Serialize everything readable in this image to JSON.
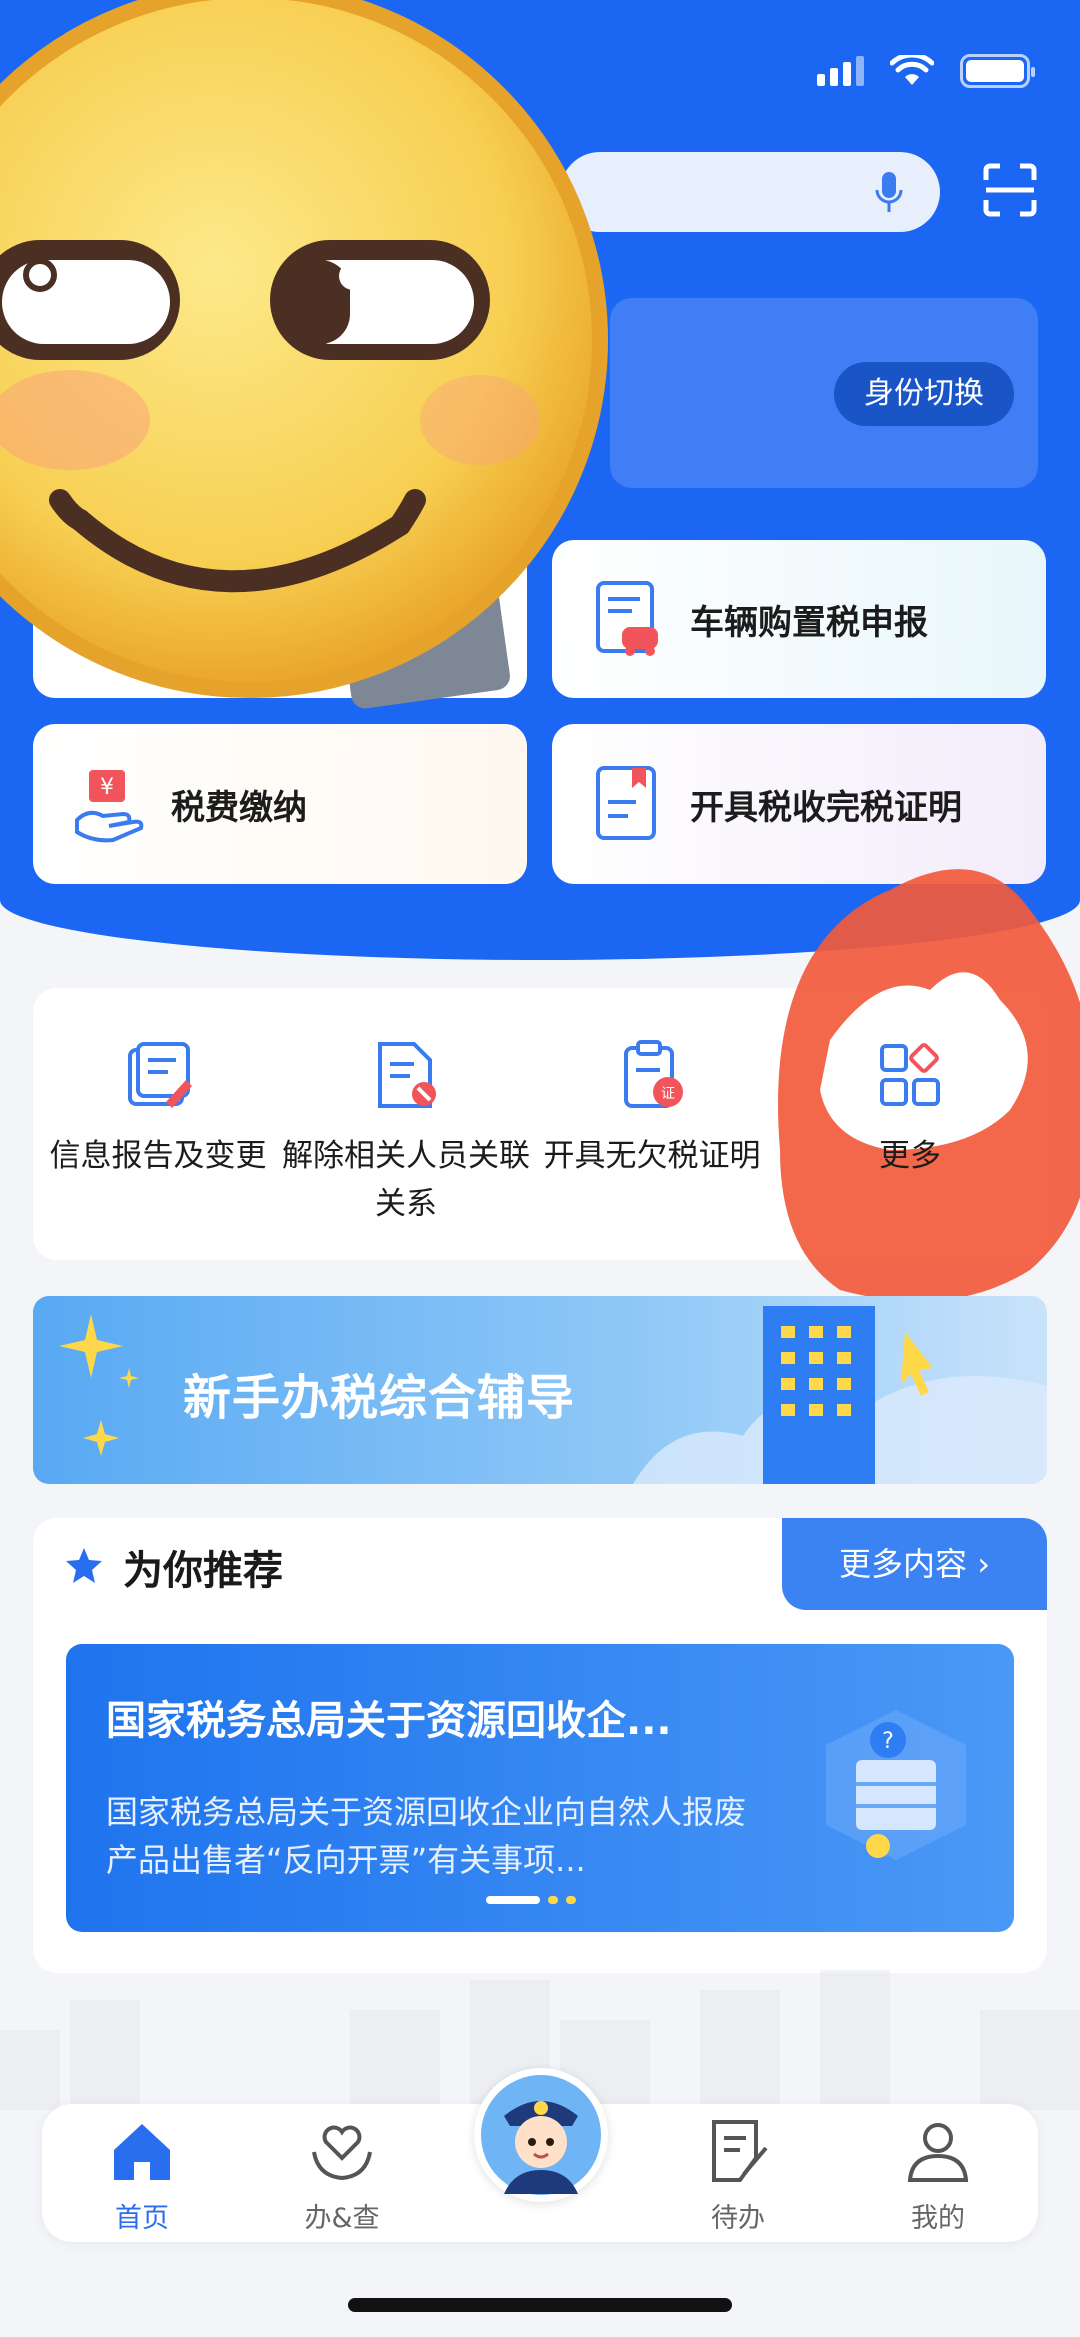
{
  "search": {
    "placeholder": ""
  },
  "identity": {
    "switch_label": "身份切换"
  },
  "quick_actions": [
    {
      "label": "车辆购置税申报",
      "icon": "vehicle-tax-icon"
    },
    {
      "label": "税费缴纳",
      "icon": "tax-payment-icon"
    },
    {
      "label": "开具税收完税证明",
      "icon": "tax-certificate-icon"
    }
  ],
  "services": [
    {
      "label": "信息报告及变更",
      "icon": "info-report-icon"
    },
    {
      "label": "解除相关人员关联关系",
      "icon": "unlink-relation-icon"
    },
    {
      "label": "开具无欠税证明",
      "icon": "no-tax-owed-cert-icon"
    },
    {
      "label": "更多",
      "icon": "more-grid-icon"
    }
  ],
  "banner": {
    "title": "新手办税综合辅导"
  },
  "recommend": {
    "title": "为你推荐",
    "more_label": "更多内容",
    "card_title": "国家税务总局关于资源回收企...",
    "card_desc": "国家税务总局关于资源回收企业向自然人报废产品出售者“反向开票”有关事项..."
  },
  "nav": {
    "home": "首页",
    "handle_query": "办&查",
    "todo": "待办",
    "mine": "我的"
  },
  "colors": {
    "brand": "#1b66f2",
    "active": "#2a6ef0",
    "sticker_red": "#f25a3c"
  }
}
